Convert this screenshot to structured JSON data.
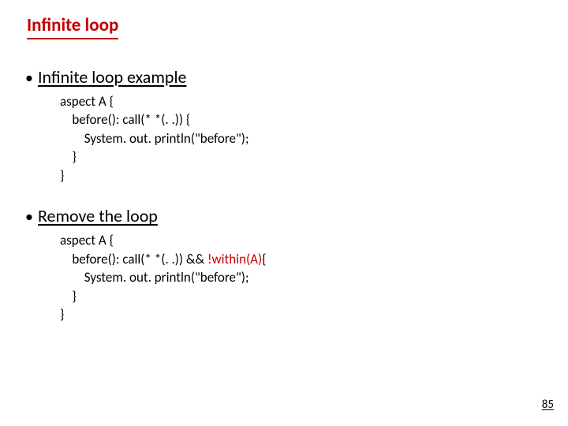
{
  "title": "Infinite loop",
  "bullets": [
    {
      "text": "Infinite loop example"
    },
    {
      "text": "Remove the loop"
    }
  ],
  "code1": {
    "l1": "aspect A {",
    "l2": "    before(): call(* *(. .)) {",
    "l3": "        System. out. println(\"before\");",
    "l4": "    }",
    "l5": "}"
  },
  "code2": {
    "l1": "aspect A {",
    "l2a": "    before(): call(* *(. .)) && ",
    "l2b": "!within(A)",
    "l2c": "{",
    "l3": "        System. out. println(\"before\");",
    "l4": "    }",
    "l5": "}"
  },
  "page_number": "85"
}
